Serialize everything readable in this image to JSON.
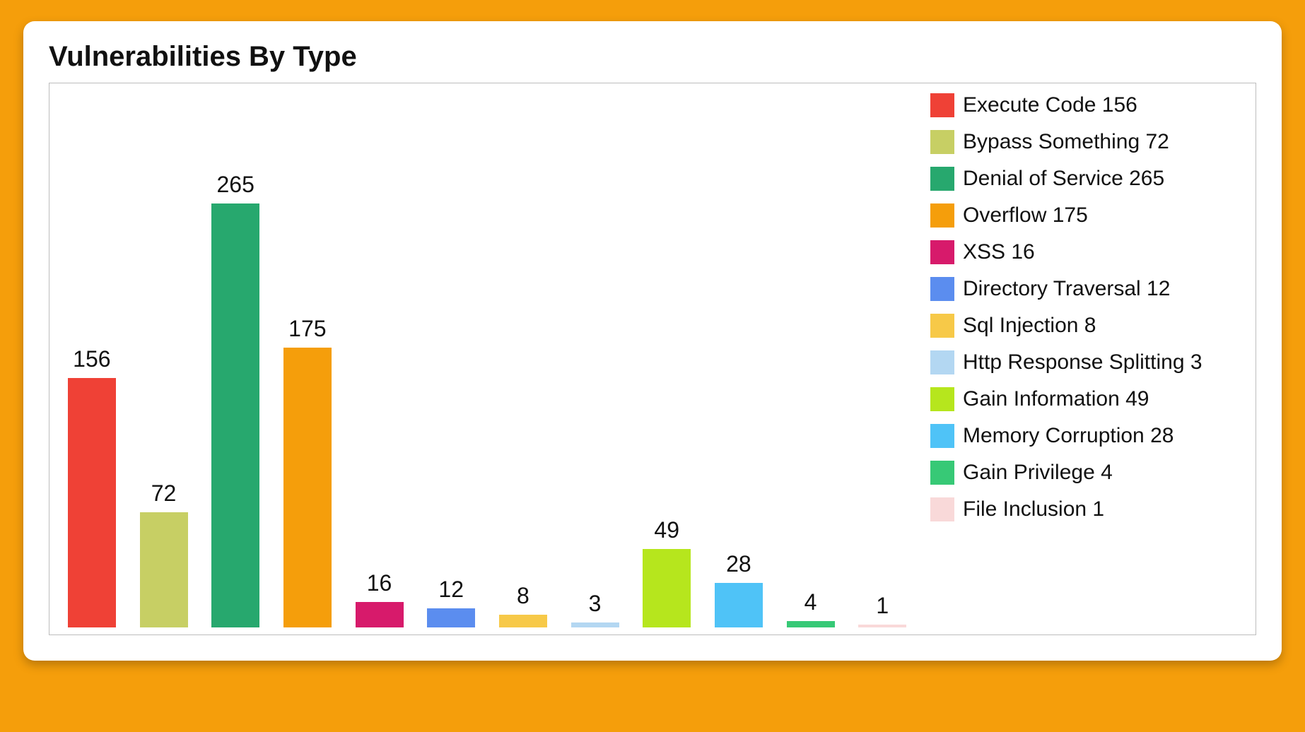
{
  "title": "Vulnerabilities By Type",
  "chart_data": {
    "type": "bar",
    "title": "Vulnerabilities By Type",
    "xlabel": "",
    "ylabel": "",
    "ylim": [
      0,
      265
    ],
    "categories": [
      "Execute Code",
      "Bypass Something",
      "Denial of Service",
      "Overflow",
      "XSS",
      "Directory Traversal",
      "Sql Injection",
      "Http Response Splitting",
      "Gain Information",
      "Memory Corruption",
      "Gain Privilege",
      "File Inclusion"
    ],
    "values": [
      156,
      72,
      265,
      175,
      16,
      12,
      8,
      3,
      49,
      28,
      4,
      1
    ],
    "colors": [
      "#ef4136",
      "#c7cf64",
      "#27a86e",
      "#f59e0b",
      "#d71a6b",
      "#5b8def",
      "#f7c948",
      "#b3d7f2",
      "#b6e61d",
      "#4fc3f7",
      "#37c976",
      "#f9d9d9"
    ],
    "legend": [
      {
        "label": "Execute Code 156",
        "color": "#ef4136"
      },
      {
        "label": "Bypass Something 72",
        "color": "#c7cf64"
      },
      {
        "label": "Denial of Service 265",
        "color": "#27a86e"
      },
      {
        "label": "Overflow 175",
        "color": "#f59e0b"
      },
      {
        "label": "XSS 16",
        "color": "#d71a6b"
      },
      {
        "label": "Directory Traversal 12",
        "color": "#5b8def"
      },
      {
        "label": "Sql Injection 8",
        "color": "#f7c948"
      },
      {
        "label": "Http Response Splitting 3",
        "color": "#b3d7f2"
      },
      {
        "label": "Gain Information 49",
        "color": "#b6e61d"
      },
      {
        "label": "Memory Corruption 28",
        "color": "#4fc3f7"
      },
      {
        "label": "Gain Privilege 4",
        "color": "#37c976"
      },
      {
        "label": "File Inclusion 1",
        "color": "#f9d9d9"
      }
    ]
  }
}
